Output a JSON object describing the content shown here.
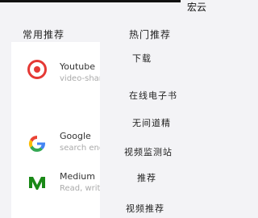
{
  "top": {
    "right_text": "宏云"
  },
  "headers": {
    "left": "常用推荐",
    "right": "热门推荐"
  },
  "apps": [
    {
      "title": "Youtube",
      "subtitle": "video-shari",
      "icon": "youtube-icon",
      "color": "#e53935"
    },
    {
      "title": "Google",
      "subtitle": "search eng",
      "icon": "google-icon",
      "color": "#4285f4"
    },
    {
      "title": "Medium",
      "subtitle": "Read, write",
      "icon": "medium-icon",
      "color": "#1a8917"
    }
  ],
  "right_items": [
    "下载",
    "在线电子书",
    "无间道精",
    "视频监测站",
    "推荐",
    "视频推荐"
  ]
}
